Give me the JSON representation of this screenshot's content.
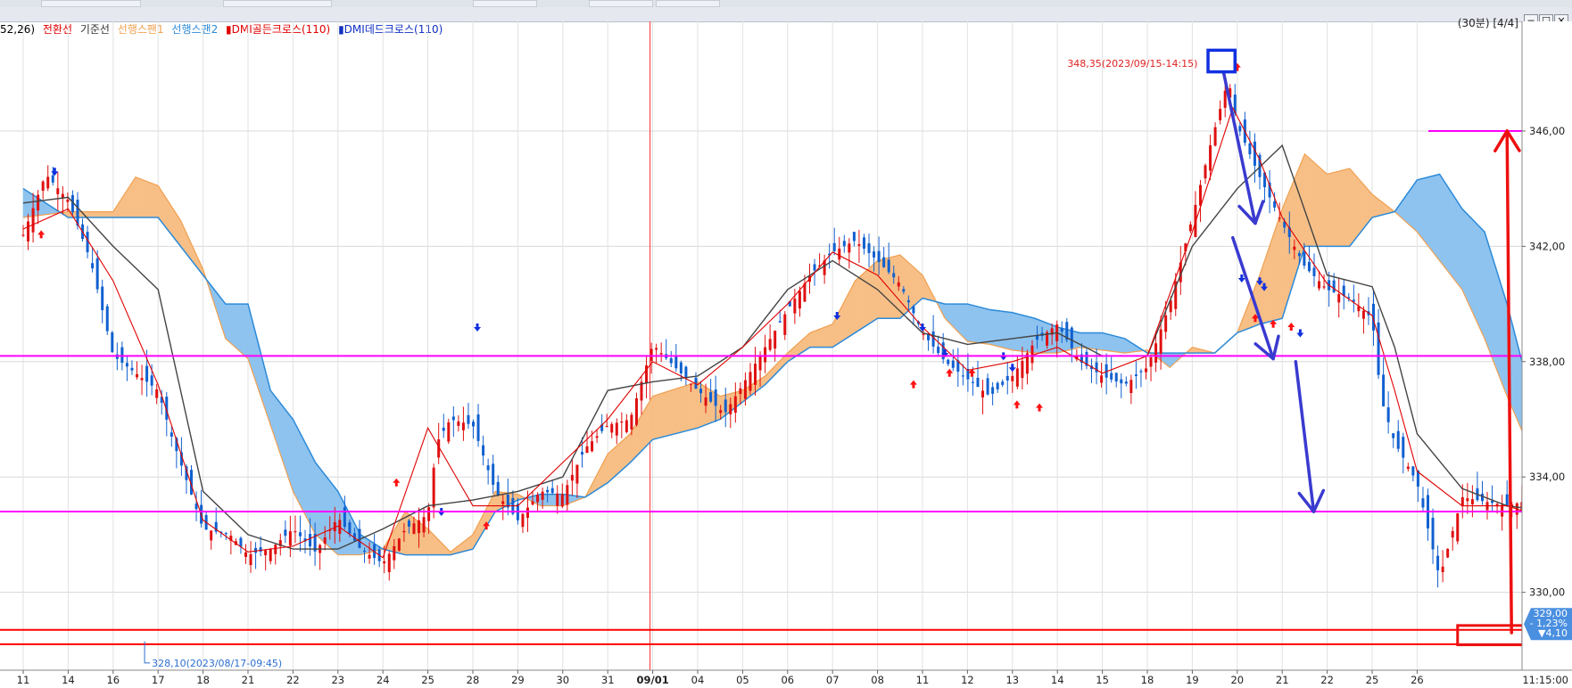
{
  "status": {
    "period": "(30분) [4/4]",
    "buttons": [
      "─",
      "☐",
      "✕"
    ]
  },
  "legend": [
    {
      "text": "52,26)",
      "color": "#000000"
    },
    {
      "text": "전환선",
      "color": "#e00000"
    },
    {
      "text": "기준선",
      "color": "#333333"
    },
    {
      "text": "선행스팬1",
      "color": "#f0a050"
    },
    {
      "text": "선행스팬2",
      "color": "#2c8ad8"
    },
    {
      "text": "▮DMI골든크로스(110)",
      "color": "#e00000"
    },
    {
      "text": "▮DMI데드크로스(110)",
      "color": "#1030c0"
    }
  ],
  "chart_data": {
    "type": "candlestick",
    "y_ticks": [
      "346,00",
      "342,00",
      "338,00",
      "334,00",
      "330,00"
    ],
    "ylim": [
      327.3,
      349.8
    ],
    "x_ticks": [
      "11",
      "14",
      "16",
      "17",
      "18",
      "21",
      "22",
      "23",
      "24",
      "25",
      "28",
      "29",
      "30",
      "31",
      "09/01",
      "04",
      "05",
      "06",
      "07",
      "08",
      "11",
      "12",
      "13",
      "14",
      "15",
      "18",
      "19",
      "20",
      "21",
      "22",
      "25",
      "26"
    ],
    "x_end_label": "11:15:00",
    "high_annotation": "348,35(2023/09/15-14:15)",
    "low_annotation": "328,10(2023/08/17-09:45)",
    "price_badge": {
      "price": "329,00",
      "change_pct": "- 1,23%",
      "change": "▼4,10"
    },
    "horizontal_lines": [
      {
        "value": 346.0,
        "color": "#ff00ff"
      },
      {
        "value": 338.2,
        "color": "#ff00ff"
      },
      {
        "value": 332.8,
        "color": "#ff00ff"
      },
      {
        "value": 328.7,
        "color": "#ff0000"
      },
      {
        "value": 328.2,
        "color": "#ff0000"
      }
    ],
    "close_path": [
      [
        0,
        342.4
      ],
      [
        0.5,
        344.5
      ],
      [
        1,
        343.6
      ],
      [
        1.5,
        341.5
      ],
      [
        2,
        338.2
      ],
      [
        3,
        337.0
      ],
      [
        3.3,
        335.4
      ],
      [
        4,
        332.2
      ],
      [
        4.6,
        332.0
      ],
      [
        5,
        331.3
      ],
      [
        5.5,
        331.5
      ],
      [
        6,
        332.2
      ],
      [
        6.5,
        331.4
      ],
      [
        7,
        332.6
      ],
      [
        7.5,
        331.5
      ],
      [
        8,
        331.0
      ],
      [
        8.5,
        332.2
      ],
      [
        9,
        332.7
      ],
      [
        9.2,
        335.2
      ],
      [
        9.5,
        336.0
      ],
      [
        10,
        335.8
      ],
      [
        10.5,
        333.5
      ],
      [
        11,
        332.5
      ],
      [
        11.5,
        333.5
      ],
      [
        12,
        333.4
      ],
      [
        12.5,
        335.0
      ],
      [
        13,
        335.8
      ],
      [
        13.5,
        336.0
      ],
      [
        14,
        338.6
      ],
      [
        15,
        337.0
      ],
      [
        15.6,
        336.2
      ],
      [
        16,
        337.2
      ],
      [
        17,
        339.8
      ],
      [
        17.5,
        341.0
      ],
      [
        18,
        341.8
      ],
      [
        18.5,
        342.2
      ],
      [
        19,
        341.5
      ],
      [
        19.5,
        340.7
      ],
      [
        20,
        339.0
      ],
      [
        20.5,
        338.0
      ],
      [
        21,
        337.4
      ],
      [
        21.5,
        336.8
      ],
      [
        22,
        337.5
      ],
      [
        22.5,
        338.7
      ],
      [
        23,
        339.3
      ],
      [
        23.5,
        338.0
      ],
      [
        24,
        337.5
      ],
      [
        24.5,
        337.2
      ],
      [
        25,
        337.8
      ],
      [
        25.5,
        340.0
      ],
      [
        26,
        343.0
      ],
      [
        26.4,
        345.5
      ],
      [
        26.8,
        347.8
      ],
      [
        27,
        346.2
      ],
      [
        27.5,
        344.4
      ],
      [
        28,
        342.8
      ],
      [
        28.5,
        341.3
      ],
      [
        29,
        340.5
      ],
      [
        29.5,
        340.2
      ],
      [
        30,
        339.5
      ],
      [
        30.2,
        336.7
      ],
      [
        30.5,
        335.2
      ],
      [
        31,
        333.8
      ],
      [
        31.5,
        330.5
      ],
      [
        32,
        333.3
      ],
      [
        33,
        333.0
      ],
      [
        33.5,
        333.2
      ],
      [
        34,
        331.3
      ],
      [
        34.3,
        329.2
      ],
      [
        34.6,
        328.8
      ]
    ],
    "tenkan": [
      [
        0,
        342.6
      ],
      [
        1,
        343.3
      ],
      [
        2,
        340.8
      ],
      [
        3,
        337.2
      ],
      [
        4,
        332.5
      ],
      [
        5,
        331.4
      ],
      [
        6,
        331.6
      ],
      [
        7,
        332.3
      ],
      [
        8,
        331.2
      ],
      [
        9,
        335.7
      ],
      [
        10,
        333.0
      ],
      [
        11,
        333.0
      ],
      [
        12,
        334.5
      ],
      [
        13,
        336.0
      ],
      [
        14,
        338.0
      ],
      [
        15,
        337.2
      ],
      [
        16,
        338.5
      ],
      [
        17,
        340.0
      ],
      [
        18,
        341.8
      ],
      [
        19,
        341.0
      ],
      [
        20,
        339.2
      ],
      [
        21,
        337.7
      ],
      [
        22,
        338.0
      ],
      [
        23,
        338.5
      ],
      [
        24,
        337.6
      ],
      [
        25,
        338.2
      ],
      [
        26,
        342.5
      ],
      [
        26.9,
        346.8
      ],
      [
        27.5,
        345.0
      ],
      [
        28,
        343.0
      ],
      [
        29,
        340.7
      ],
      [
        30,
        339.6
      ],
      [
        30.5,
        337.0
      ],
      [
        31,
        334.2
      ],
      [
        32,
        333.0
      ],
      [
        33,
        333.0
      ],
      [
        34,
        332.5
      ],
      [
        34.6,
        331.2
      ]
    ],
    "kijun": [
      [
        0,
        343.5
      ],
      [
        1,
        343.7
      ],
      [
        2,
        342.0
      ],
      [
        3,
        340.5
      ],
      [
        3.5,
        337.0
      ],
      [
        4,
        333.5
      ],
      [
        5,
        332.0
      ],
      [
        6,
        331.5
      ],
      [
        7,
        331.5
      ],
      [
        8,
        332.2
      ],
      [
        9,
        333.0
      ],
      [
        10,
        333.2
      ],
      [
        11,
        333.5
      ],
      [
        12,
        334.0
      ],
      [
        13,
        337.0
      ],
      [
        14,
        337.3
      ],
      [
        15,
        337.5
      ],
      [
        16,
        338.5
      ],
      [
        17,
        340.5
      ],
      [
        18,
        341.5
      ],
      [
        19,
        340.5
      ],
      [
        20,
        339.0
      ],
      [
        21,
        338.6
      ],
      [
        22,
        338.8
      ],
      [
        23,
        339.0
      ],
      [
        24,
        338.2
      ],
      [
        25,
        338.2
      ],
      [
        26,
        342.0
      ],
      [
        27,
        344.0
      ],
      [
        28,
        345.5
      ],
      [
        29,
        341.0
      ],
      [
        30,
        340.6
      ],
      [
        30.5,
        338.5
      ],
      [
        31,
        335.5
      ],
      [
        32,
        333.6
      ],
      [
        33,
        333.0
      ],
      [
        34,
        332.8
      ],
      [
        34.6,
        331.1
      ]
    ],
    "span1": [
      [
        0,
        343.0
      ],
      [
        1,
        343.2
      ],
      [
        2,
        343.2
      ],
      [
        2.5,
        344.4
      ],
      [
        3,
        344.1
      ],
      [
        3.5,
        342.9
      ],
      [
        4,
        341.2
      ],
      [
        4.5,
        338.8
      ],
      [
        5,
        338.1
      ],
      [
        5.5,
        335.8
      ],
      [
        6,
        333.5
      ],
      [
        6.5,
        332.0
      ],
      [
        7,
        331.3
      ],
      [
        7.5,
        331.3
      ],
      [
        8,
        331.5
      ],
      [
        8.5,
        332.8
      ],
      [
        9,
        332.2
      ],
      [
        9.5,
        331.4
      ],
      [
        10,
        332.0
      ],
      [
        10.5,
        333.5
      ],
      [
        11,
        333.4
      ],
      [
        11.5,
        333.0
      ],
      [
        12,
        333.0
      ],
      [
        12.5,
        333.3
      ],
      [
        13,
        334.8
      ],
      [
        13.5,
        335.5
      ],
      [
        14,
        336.8
      ],
      [
        15,
        337.3
      ],
      [
        15.5,
        336.8
      ],
      [
        16,
        337.0
      ],
      [
        16.5,
        337.5
      ],
      [
        17,
        338.3
      ],
      [
        17.5,
        339.0
      ],
      [
        18,
        339.3
      ],
      [
        18.5,
        340.8
      ],
      [
        19,
        341.5
      ],
      [
        19.5,
        341.7
      ],
      [
        20,
        341.0
      ],
      [
        20.5,
        339.5
      ],
      [
        21,
        338.7
      ],
      [
        21.5,
        338.6
      ],
      [
        22,
        338.4
      ],
      [
        22.5,
        338.3
      ],
      [
        23,
        338.3
      ],
      [
        23.5,
        338.5
      ],
      [
        24,
        338.4
      ],
      [
        24.5,
        338.3
      ],
      [
        25,
        338.4
      ],
      [
        25.5,
        337.8
      ],
      [
        26,
        338.5
      ],
      [
        26.5,
        338.3
      ],
      [
        27,
        339.0
      ],
      [
        27.5,
        341.0
      ],
      [
        28,
        343.3
      ],
      [
        28.5,
        345.2
      ],
      [
        29,
        344.5
      ],
      [
        29.5,
        344.7
      ],
      [
        30,
        343.8
      ],
      [
        30.5,
        343.2
      ],
      [
        31,
        342.5
      ],
      [
        31.5,
        341.5
      ],
      [
        32,
        340.5
      ],
      [
        32.5,
        338.8
      ],
      [
        33,
        336.8
      ],
      [
        33.5,
        335.0
      ],
      [
        34,
        333.3
      ],
      [
        34.5,
        332.5
      ],
      [
        35,
        332.2
      ],
      [
        35.5,
        331.1
      ]
    ],
    "span2": [
      [
        0,
        344.0
      ],
      [
        1,
        343.0
      ],
      [
        2,
        343.0
      ],
      [
        2.5,
        343.0
      ],
      [
        3,
        343.0
      ],
      [
        3.5,
        342.0
      ],
      [
        4,
        341.0
      ],
      [
        4.5,
        340.0
      ],
      [
        5,
        340.0
      ],
      [
        5.5,
        337.0
      ],
      [
        6,
        336.0
      ],
      [
        6.5,
        334.5
      ],
      [
        7,
        333.5
      ],
      [
        7.5,
        332.0
      ],
      [
        8,
        331.5
      ],
      [
        8.5,
        331.3
      ],
      [
        9,
        331.3
      ],
      [
        9.5,
        331.3
      ],
      [
        10,
        331.5
      ],
      [
        10.5,
        332.8
      ],
      [
        11,
        333.2
      ],
      [
        11.5,
        333.4
      ],
      [
        12,
        333.4
      ],
      [
        12.5,
        333.3
      ],
      [
        13,
        333.8
      ],
      [
        13.5,
        334.5
      ],
      [
        14,
        335.3
      ],
      [
        15,
        335.7
      ],
      [
        15.5,
        336.0
      ],
      [
        16,
        336.6
      ],
      [
        16.5,
        337.2
      ],
      [
        17,
        338.0
      ],
      [
        17.5,
        338.5
      ],
      [
        18,
        338.5
      ],
      [
        18.5,
        339.0
      ],
      [
        19,
        339.5
      ],
      [
        19.5,
        339.5
      ],
      [
        20,
        340.2
      ],
      [
        20.5,
        340.0
      ],
      [
        21,
        340.0
      ],
      [
        21.5,
        339.8
      ],
      [
        22,
        339.7
      ],
      [
        22.5,
        339.5
      ],
      [
        23,
        339.2
      ],
      [
        23.5,
        339.0
      ],
      [
        24,
        339.0
      ],
      [
        24.5,
        338.8
      ],
      [
        25,
        338.3
      ],
      [
        25.5,
        338.3
      ],
      [
        26,
        338.3
      ],
      [
        26.5,
        338.3
      ],
      [
        27,
        339.0
      ],
      [
        27.5,
        339.3
      ],
      [
        28,
        339.5
      ],
      [
        28.5,
        342.0
      ],
      [
        29,
        342.0
      ],
      [
        29.5,
        342.0
      ],
      [
        30,
        343.0
      ],
      [
        30.5,
        343.2
      ],
      [
        31,
        344.3
      ],
      [
        31.5,
        344.5
      ],
      [
        32,
        343.3
      ],
      [
        32.5,
        342.5
      ],
      [
        33,
        340.0
      ],
      [
        33.5,
        337.0
      ],
      [
        34,
        336.0
      ],
      [
        34.5,
        336.0
      ],
      [
        35,
        335.5
      ],
      [
        35.5,
        334.6
      ]
    ],
    "golden_markers": [
      [
        0.4,
        342.4
      ],
      [
        8.3,
        333.8
      ],
      [
        10.3,
        332.3
      ],
      [
        19.8,
        337.2
      ],
      [
        20.6,
        337.6
      ],
      [
        21.1,
        337.6
      ],
      [
        22.1,
        336.5
      ],
      [
        22.6,
        336.4
      ],
      [
        27.0,
        348.2
      ],
      [
        27.4,
        339.5
      ],
      [
        27.8,
        339.3
      ],
      [
        28.2,
        339.2
      ]
    ],
    "dead_markers": [
      [
        0.7,
        344.6
      ],
      [
        9.3,
        332.8
      ],
      [
        10.1,
        339.2
      ],
      [
        18.1,
        339.6
      ],
      [
        20.0,
        339.2
      ],
      [
        20.5,
        338.3
      ],
      [
        21.8,
        338.2
      ],
      [
        22.0,
        337.8
      ],
      [
        27.1,
        340.9
      ],
      [
        27.5,
        340.8
      ],
      [
        27.6,
        340.6
      ],
      [
        28.4,
        339.0
      ]
    ],
    "annotation_arrows": [
      {
        "from": [
          26.7,
          348.0
        ],
        "to": [
          27.4,
          342.8
        ]
      },
      {
        "from": [
          26.9,
          342.3
        ],
        "to": [
          27.8,
          338.1
        ]
      },
      {
        "from": [
          28.3,
          338.0
        ],
        "to": [
          28.7,
          332.8
        ]
      }
    ],
    "target_arrow": {
      "from": [
        33.1,
        328.6
      ],
      "to": [
        33.0,
        346.0
      ]
    },
    "top_box": [
      26.35,
      26.95,
      348.05,
      348.8
    ],
    "bottom_box": [
      31.9,
      33.35,
      328.18,
      328.85
    ]
  }
}
